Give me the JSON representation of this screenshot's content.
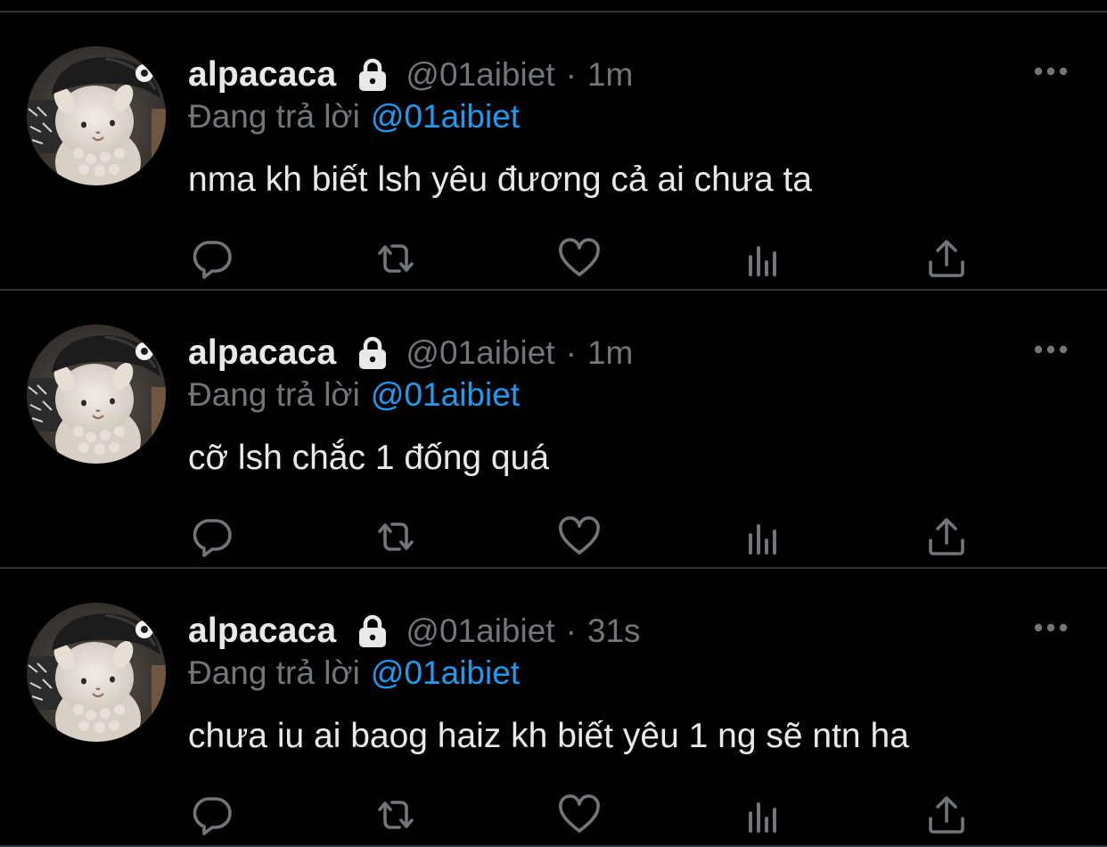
{
  "theme": {
    "background": "#000000",
    "text": "#E7E9EA",
    "muted": "#71767B",
    "link": "#1D9BF0",
    "divider": "#2F3336"
  },
  "tweets": [
    {
      "display_name": "alpacaca",
      "handle": "@01aibiet",
      "separator": "·",
      "time": "1m",
      "reply_prefix": "Đang trả lời",
      "reply_to": "@01aibiet",
      "text": "nma kh biết lsh yêu đương cả ai chưa ta",
      "icons": [
        "lock-icon",
        "more-icon",
        "reply-icon",
        "retweet-icon",
        "like-icon",
        "analytics-icon",
        "share-icon"
      ]
    },
    {
      "display_name": "alpacaca",
      "handle": "@01aibiet",
      "separator": "·",
      "time": "1m",
      "reply_prefix": "Đang trả lời",
      "reply_to": "@01aibiet",
      "text": "cỡ lsh chắc 1 đống quá",
      "icons": [
        "lock-icon",
        "more-icon",
        "reply-icon",
        "retweet-icon",
        "like-icon",
        "analytics-icon",
        "share-icon"
      ]
    },
    {
      "display_name": "alpacaca",
      "handle": "@01aibiet",
      "separator": "·",
      "time": "31s",
      "reply_prefix": "Đang trả lời",
      "reply_to": "@01aibiet",
      "text": "chưa iu ai baog haiz kh biết yêu 1 ng sẽ ntn ha",
      "icons": [
        "lock-icon",
        "more-icon",
        "reply-icon",
        "retweet-icon",
        "like-icon",
        "analytics-icon",
        "share-icon"
      ]
    }
  ]
}
